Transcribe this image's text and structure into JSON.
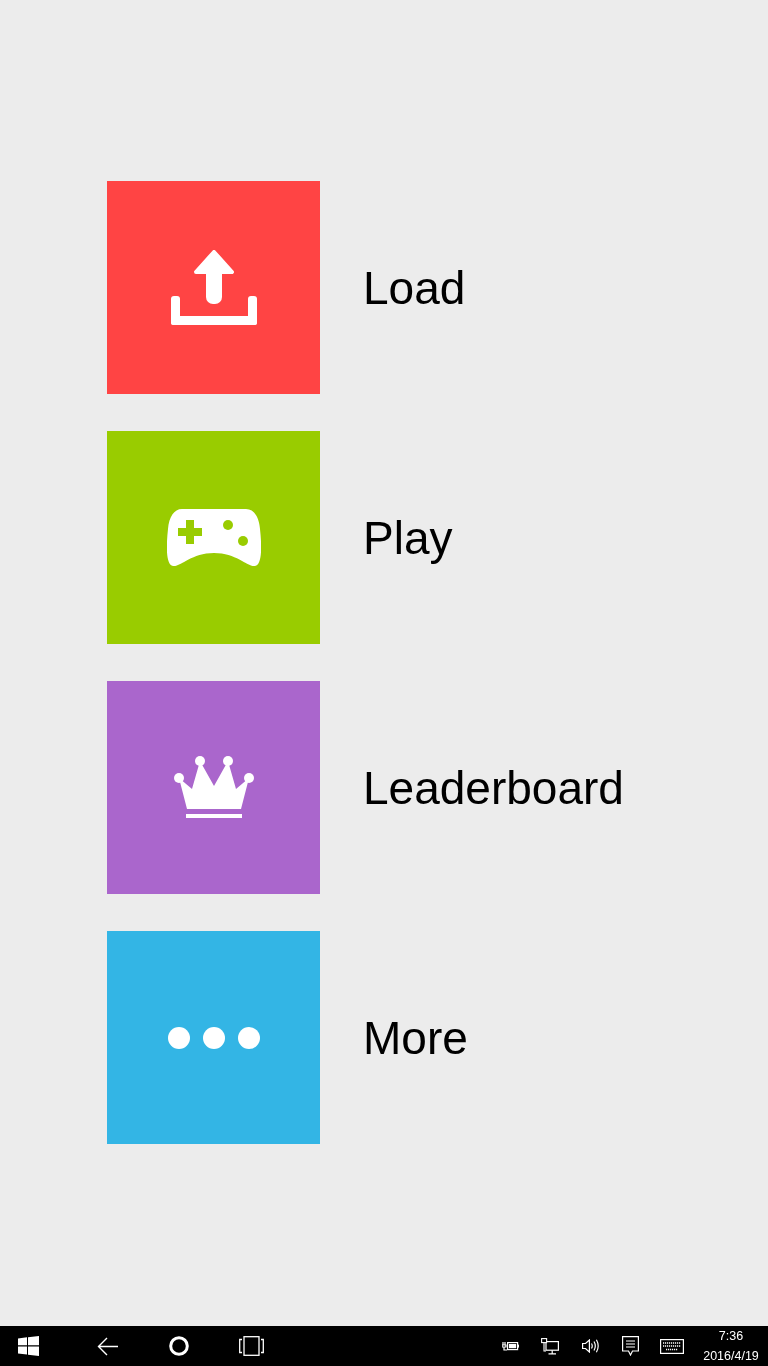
{
  "menu": [
    {
      "kind": "upload",
      "label": "Load",
      "color": "#ff4444"
    },
    {
      "kind": "gamepad",
      "label": "Play",
      "color": "#99cc00"
    },
    {
      "kind": "crown",
      "label": "Leaderboard",
      "color": "#aa66cc"
    },
    {
      "kind": "dots",
      "label": "More",
      "color": "#33b5e5"
    }
  ],
  "taskbar": {
    "time": "7:36",
    "date": "2016/4/19"
  }
}
